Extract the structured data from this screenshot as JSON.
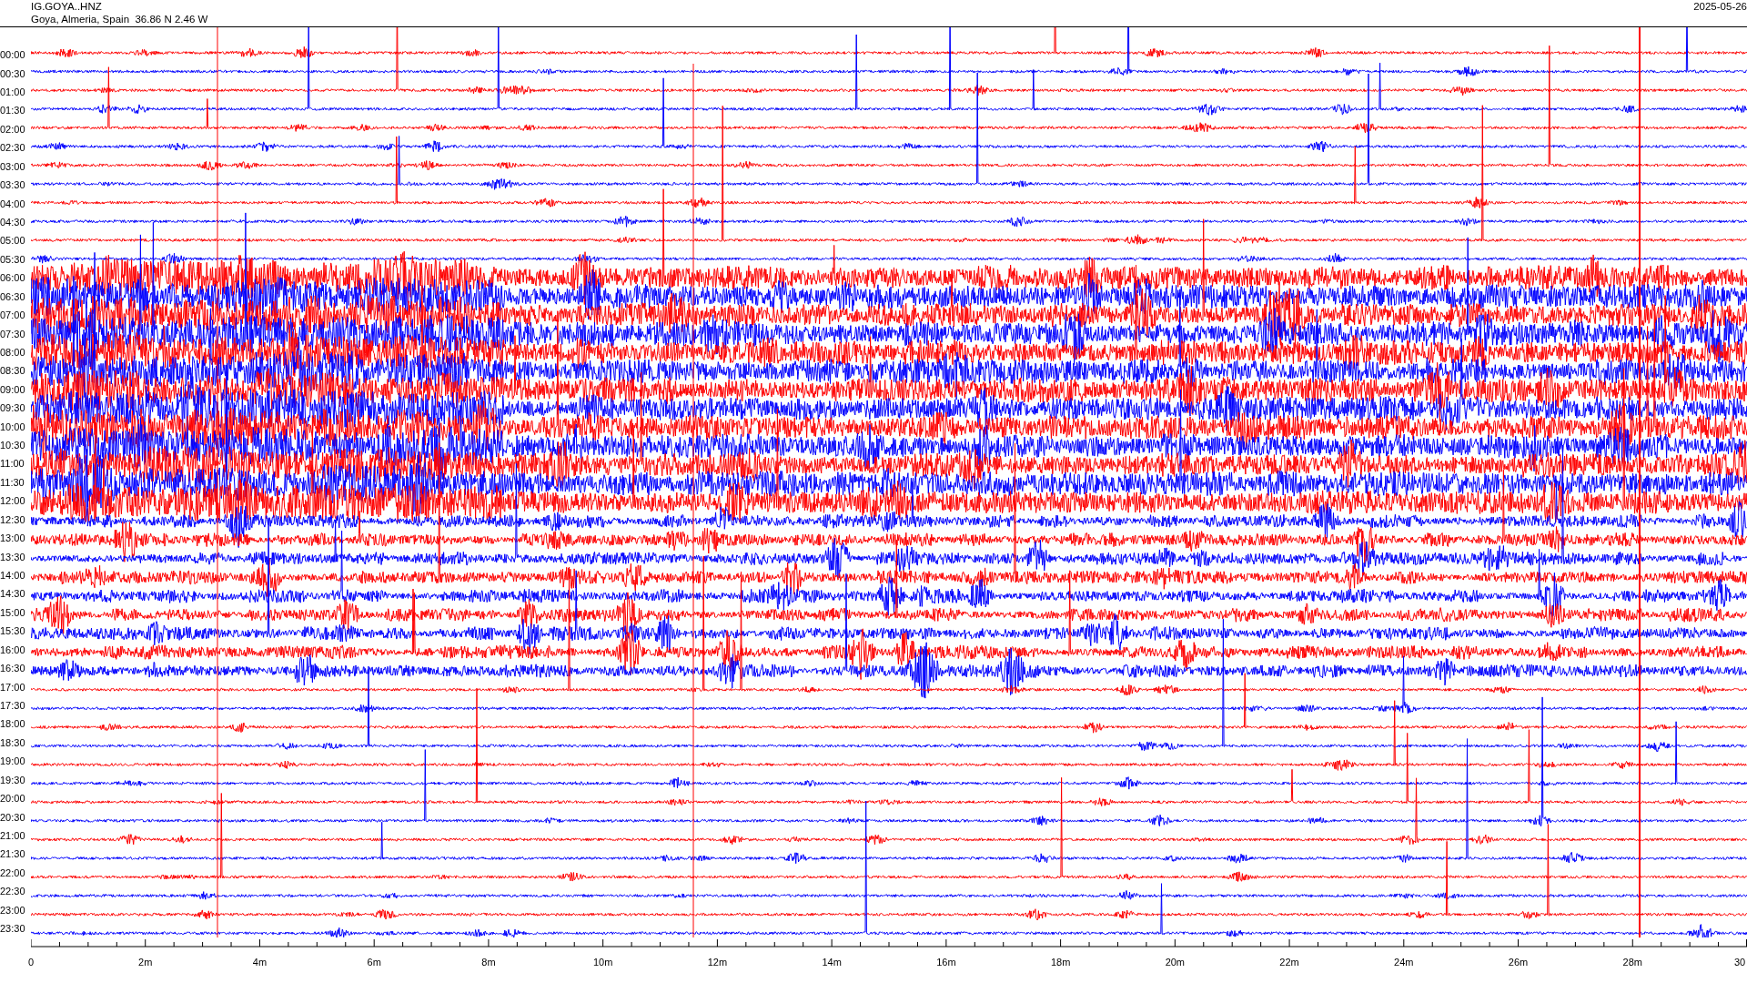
{
  "header": {
    "station": "IG.GOYA..HNZ",
    "location": "Goya, Almeria, Spain  36.86 N 2.46 W",
    "date": "2025-05-26"
  },
  "traces": [
    {
      "label": "00:00"
    },
    {
      "label": "00:30"
    },
    {
      "label": "01:00"
    },
    {
      "label": "01:30"
    },
    {
      "label": "02:00"
    },
    {
      "label": "02:30"
    },
    {
      "label": "03:00"
    },
    {
      "label": "03:30"
    },
    {
      "label": "04:00"
    },
    {
      "label": "04:30"
    },
    {
      "label": "05:00"
    },
    {
      "label": "05:30"
    },
    {
      "label": "06:00"
    },
    {
      "label": "06:30"
    },
    {
      "label": "07:00"
    },
    {
      "label": "07:30"
    },
    {
      "label": "08:00"
    },
    {
      "label": "08:30"
    },
    {
      "label": "09:00"
    },
    {
      "label": "09:30"
    },
    {
      "label": "10:00"
    },
    {
      "label": "10:30"
    },
    {
      "label": "11:00"
    },
    {
      "label": "11:30"
    },
    {
      "label": "12:00"
    },
    {
      "label": "12:30"
    },
    {
      "label": "13:00"
    },
    {
      "label": "13:30"
    },
    {
      "label": "14:00"
    },
    {
      "label": "14:30"
    },
    {
      "label": "15:00"
    },
    {
      "label": "15:30"
    },
    {
      "label": "16:00"
    },
    {
      "label": "16:30"
    },
    {
      "label": "17:00"
    },
    {
      "label": "17:30"
    },
    {
      "label": "18:00"
    },
    {
      "label": "18:30"
    },
    {
      "label": "19:00"
    },
    {
      "label": "19:30"
    },
    {
      "label": "20:00"
    },
    {
      "label": "20:30"
    },
    {
      "label": "21:00"
    },
    {
      "label": "21:30"
    },
    {
      "label": "22:00"
    },
    {
      "label": "22:30"
    },
    {
      "label": "23:00"
    },
    {
      "label": "23:30"
    }
  ],
  "x_axis": [
    "0",
    "2m",
    "4m",
    "6m",
    "8m",
    "10m",
    "12m",
    "14m",
    "16m",
    "18m",
    "20m",
    "22m",
    "24m",
    "26m",
    "28m",
    "30"
  ]
}
